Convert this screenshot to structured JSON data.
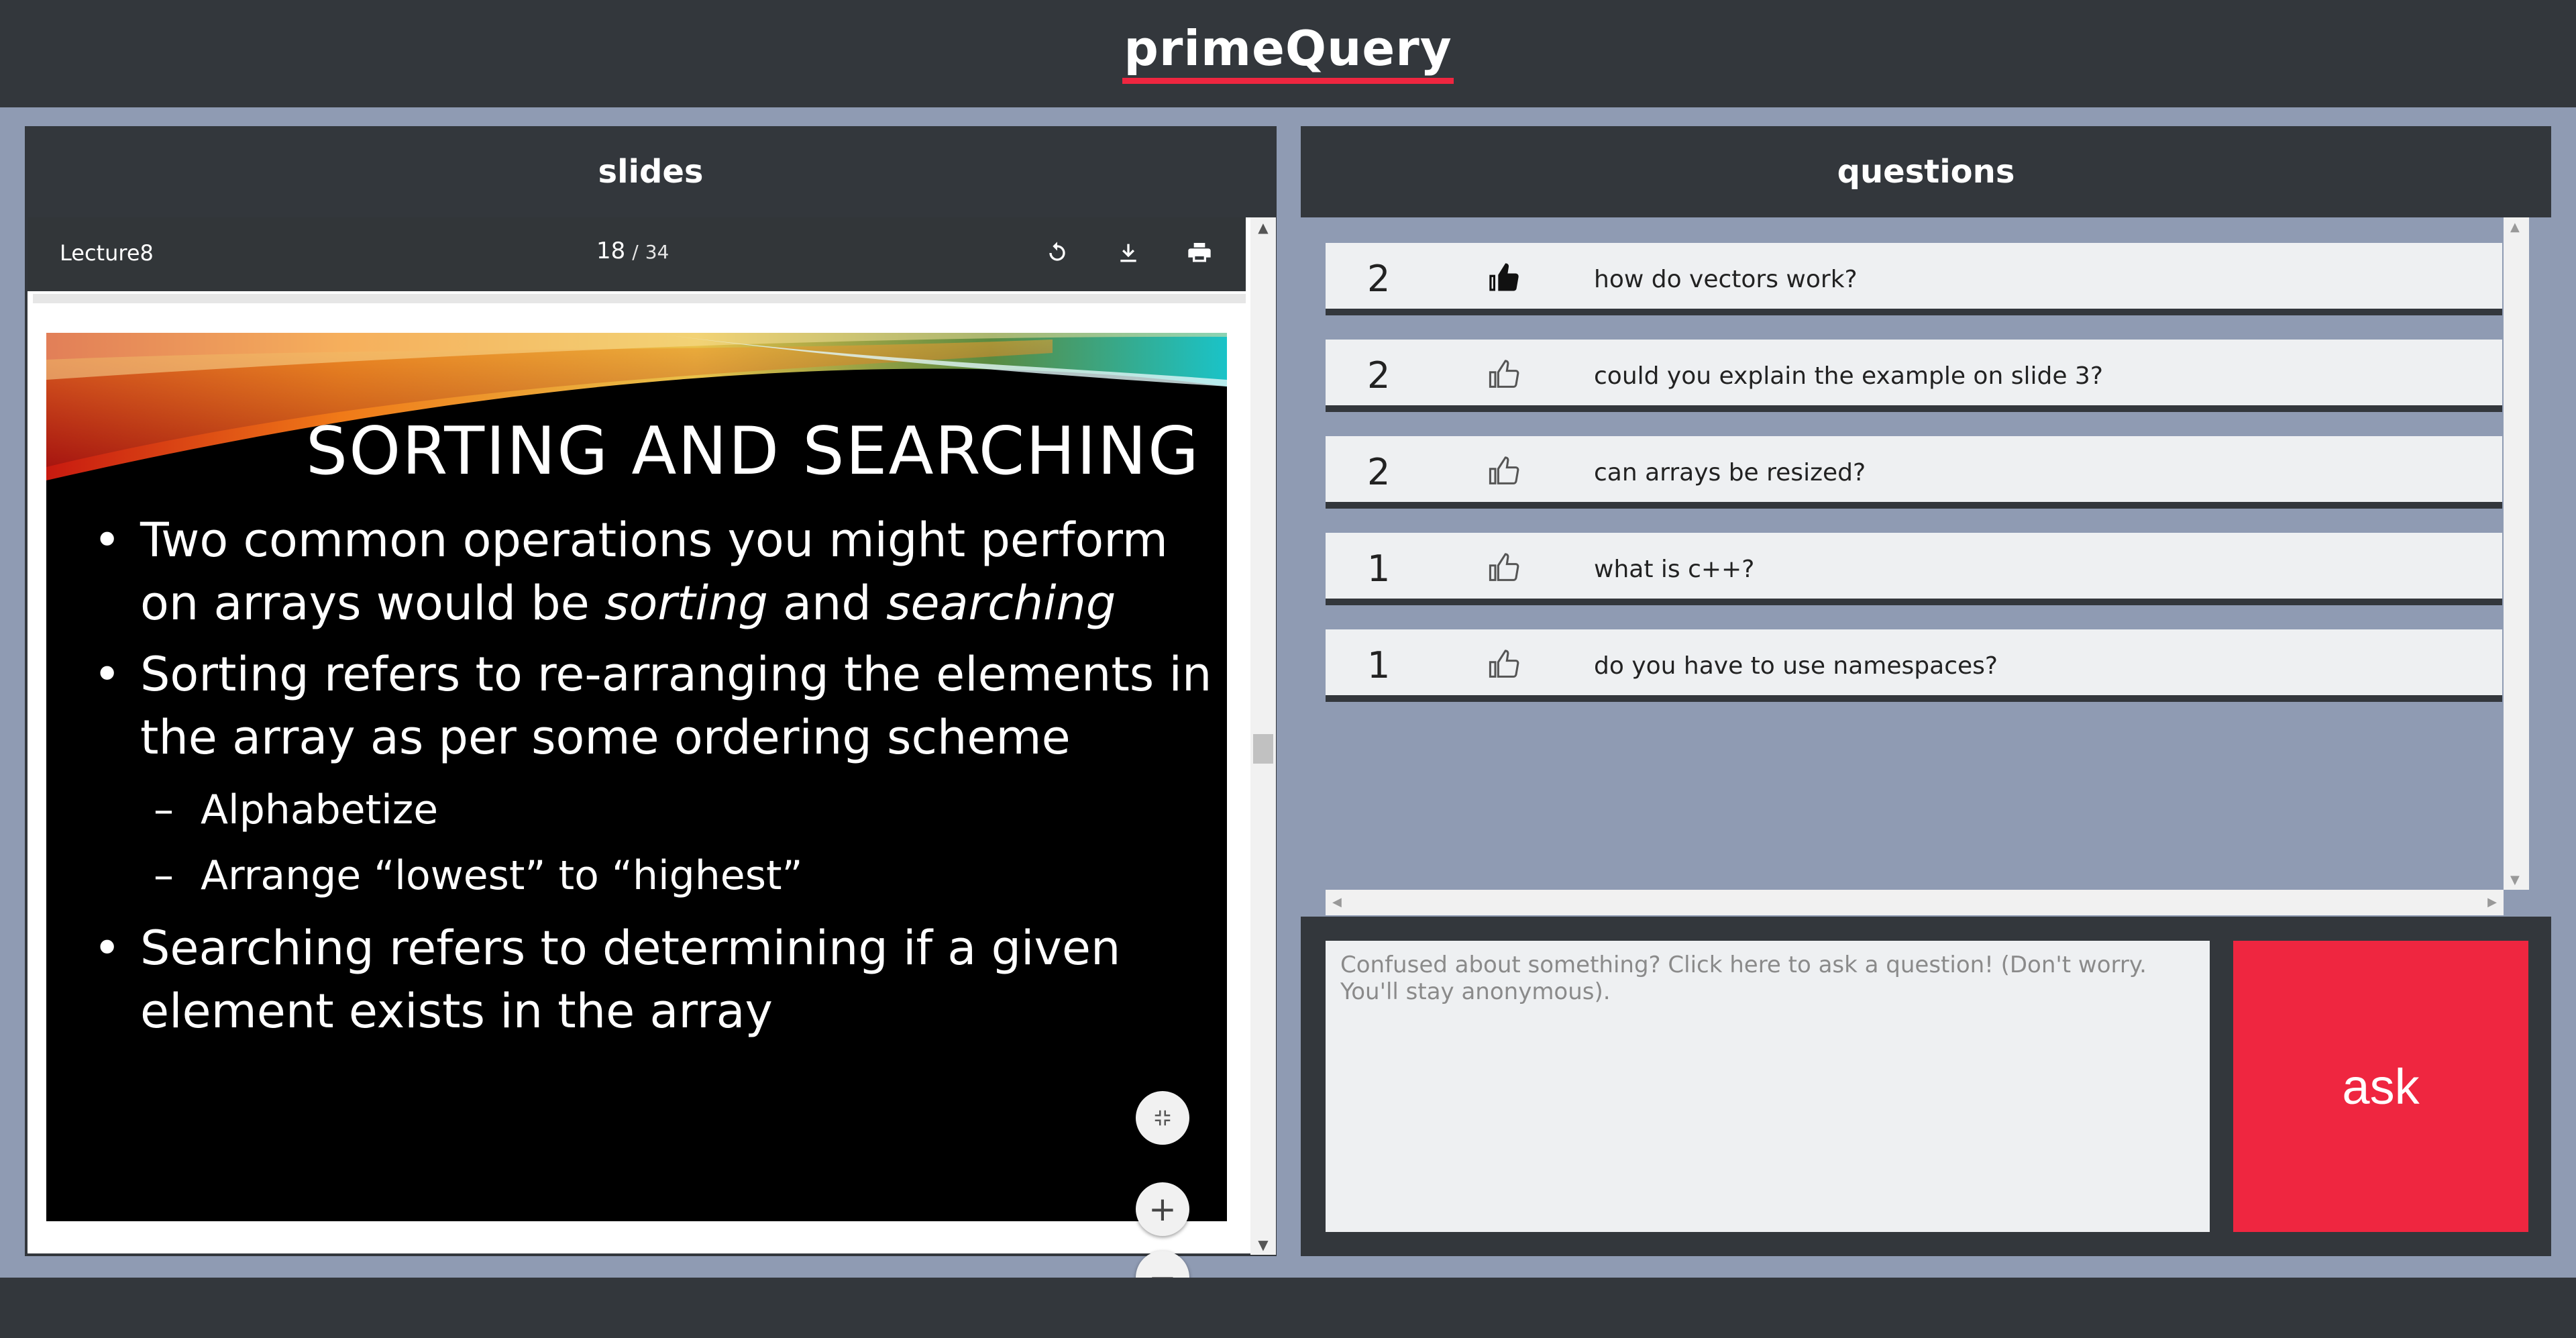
{
  "app": {
    "title": "primeQuery"
  },
  "slides_panel": {
    "title": "slides",
    "pdf": {
      "file_name": "Lecture8",
      "current_page": "18",
      "separator": "/",
      "total_pages": "34",
      "icons": [
        "rotate-icon",
        "download-icon",
        "print-icon"
      ]
    },
    "slide": {
      "title": "SORTING AND SEARCHING",
      "bullet1_a": "Two common operations you might perform on arrays would be ",
      "bullet1_em1": "sorting",
      "bullet1_and": " and ",
      "bullet1_em2": "searching",
      "bullet2": "Sorting refers to re-arranging the elements in the array as per some ordering scheme",
      "sub1": "Alphabetize",
      "sub2": "Arrange “lowest” to “highest”",
      "bullet3": "Searching refers to determining if a given element exists in the array",
      "dash": "–"
    },
    "zoom": {
      "fit": "⤡",
      "in": "+",
      "out": "−"
    }
  },
  "questions_panel": {
    "title": "questions",
    "items": [
      {
        "count": "2",
        "text": "how do vectors work?",
        "liked": true
      },
      {
        "count": "2",
        "text": "could you explain the example on slide 3?",
        "liked": false
      },
      {
        "count": "2",
        "text": "can arrays be resized?",
        "liked": false
      },
      {
        "count": "1",
        "text": "what is c++?",
        "liked": false
      },
      {
        "count": "1",
        "text": "do you have to use namespaces?",
        "liked": false
      }
    ]
  },
  "ask": {
    "placeholder": "Confused about something? Click here to ask a question! (Don't worry. You'll stay anonymous).",
    "button_label": "ask"
  },
  "colors": {
    "dark": "#33373c",
    "background": "#8f9bb3",
    "accent": "#ef2640",
    "row": "#eef0f2"
  }
}
